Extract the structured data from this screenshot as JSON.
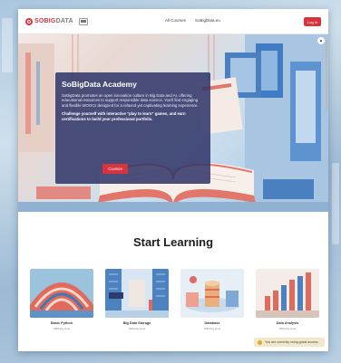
{
  "header": {
    "logo_so": "SOBIG",
    "logo_data": "DATA",
    "nav": [
      "All Courses",
      "SoBigData.eu"
    ],
    "login": "Log in"
  },
  "hero": {
    "title": "SoBigData Academy",
    "description": "SoBigData promotes an open innovation culture in Big Data and AI, offering educational resources to support responsible data science. You'll find engaging and flexible MOOCs designed for a relaxed yet captivating learning experience.",
    "challenge": "Challenge yourself with interactive \"play to learn\" games, and earn certifications to build your professional portfolio.",
    "button": "Courses"
  },
  "learning": {
    "title": "Start Learning",
    "courses": [
      {
        "title": "Basic Python",
        "meta": "Difficulty level"
      },
      {
        "title": "Big Data Storage",
        "meta": "Difficulty level"
      },
      {
        "title": "Database",
        "meta": "Difficulty level"
      },
      {
        "title": "Data Analysis",
        "meta": "Difficulty level"
      }
    ]
  },
  "guest_notice": "You are currently using guest access",
  "colors": {
    "accent": "#d9333f",
    "card_bg": "#2e3468"
  }
}
